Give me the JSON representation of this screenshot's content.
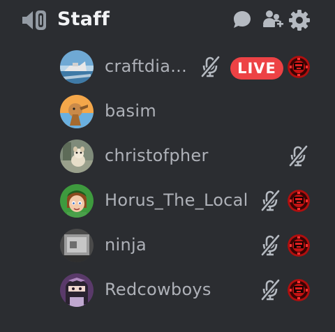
{
  "channel": {
    "name": "Staff",
    "icon": "voice-speaker-icon"
  },
  "header_actions": [
    "chat-bubble-icon",
    "invite-members-icon",
    "settings-gear-icon"
  ],
  "colors": {
    "background": "#2b2d31",
    "text": "#aeb1b8",
    "title": "#f2f3f5",
    "icon": "#b5bac1",
    "live": "#ed4245"
  },
  "live_label": "LIVE",
  "users": [
    {
      "name": "craftdia...",
      "muted": true,
      "live": true,
      "activity_icon": true
    },
    {
      "name": "basim",
      "muted": false,
      "live": false,
      "activity_icon": false
    },
    {
      "name": "christofpher",
      "muted": true,
      "live": false,
      "activity_icon": false
    },
    {
      "name": "Horus_The_Local",
      "muted": true,
      "live": false,
      "activity_icon": true
    },
    {
      "name": "ninja",
      "muted": true,
      "live": false,
      "activity_icon": true
    },
    {
      "name": "Redcowboys",
      "muted": true,
      "live": false,
      "activity_icon": true
    }
  ]
}
